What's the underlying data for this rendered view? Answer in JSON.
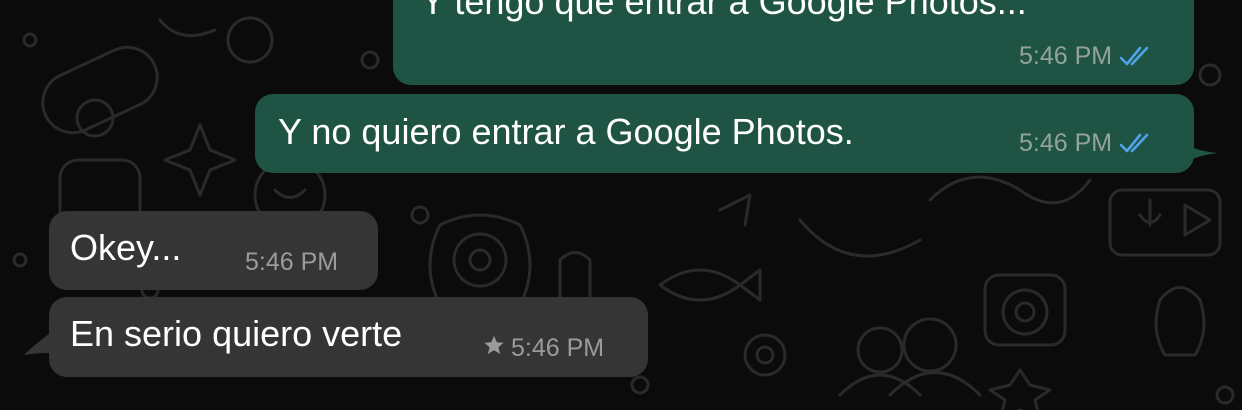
{
  "colors": {
    "background": "#0b0b0b",
    "outgoing_bubble": "#1f5344",
    "incoming_bubble": "#353535",
    "read_ticks": "#4fa3e8",
    "meta_text_out": "#93a39c",
    "meta_text_in": "#9b9b9b"
  },
  "chat": {
    "messages": [
      {
        "direction": "outgoing",
        "text": "Y tengo que entrar a Google Photos...",
        "time": "5:46 PM",
        "status_icon": "double-check-read-icon"
      },
      {
        "direction": "outgoing",
        "text": "Y no quiero entrar a Google Photos.",
        "time": "5:46 PM",
        "status_icon": "double-check-read-icon"
      },
      {
        "direction": "incoming",
        "text": "Okey...",
        "time": "5:46 PM"
      },
      {
        "direction": "incoming",
        "text": "En serio quiero verte",
        "time": "5:46 PM",
        "starred_icon": "star-icon"
      }
    ]
  }
}
